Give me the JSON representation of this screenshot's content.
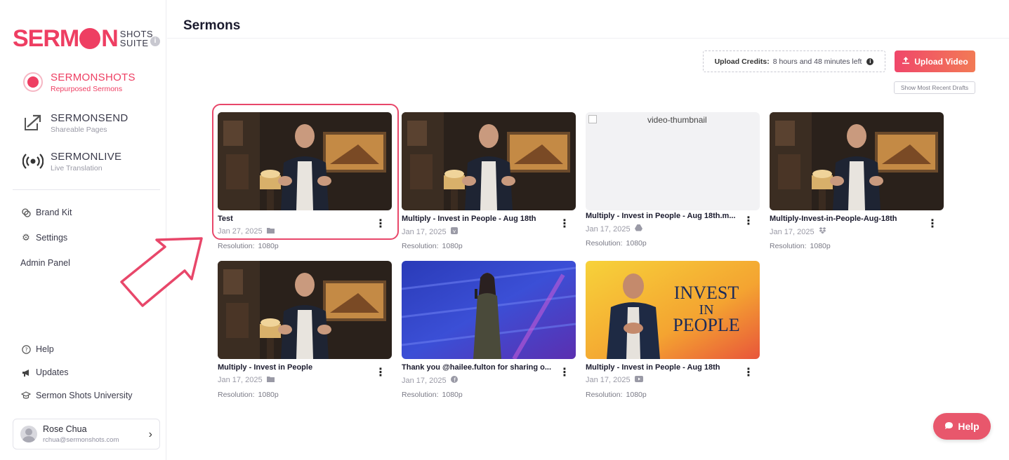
{
  "brand": {
    "logo_main_left": "SERM",
    "logo_main_right": "N",
    "logo_side_top": "SHOTS",
    "logo_side_bottom": "SUITE",
    "accent": "#ee3e62"
  },
  "products": [
    {
      "name": "SERMONSHOTS",
      "sub": "Repurposed Sermons",
      "icon": "record-icon",
      "active": true
    },
    {
      "name": "SERMONSEND",
      "sub": "Shareable Pages",
      "icon": "send-icon",
      "active": false
    },
    {
      "name": "SERMONLIVE",
      "sub": "Live Translation",
      "icon": "broadcast-icon",
      "active": false
    }
  ],
  "nav": {
    "brand_kit": "Brand Kit",
    "settings": "Settings",
    "admin_panel": "Admin Panel",
    "help": "Help",
    "updates": "Updates",
    "university": "Sermon Shots University"
  },
  "user": {
    "name": "Rose Chua",
    "email": "rchua@sermonshots.com"
  },
  "header": {
    "title": "Sermons",
    "credits_label": "Upload Credits:",
    "credits_value": "8 hours and 48 minutes left",
    "upload_label": "Upload Video",
    "drafts_label": "Show Most Recent Drafts"
  },
  "cards": [
    {
      "title": "Test",
      "date": "Jan 27, 2025",
      "source": "folder-icon",
      "res_label": "Resolution:",
      "res": "1080p",
      "thumb": "room"
    },
    {
      "title": "Multiply - Invest in People - Aug 18th",
      "date": "Jan 17, 2025",
      "source": "vimeo-icon",
      "res_label": "Resolution:",
      "res": "1080p",
      "thumb": "room"
    },
    {
      "title": "Multiply - Invest in People - Aug 18th.m...",
      "date": "Jan 17, 2025",
      "source": "google-drive-icon",
      "res_label": "Resolution:",
      "res": "1080p",
      "thumb": "broken",
      "alt": "video-thumbnail"
    },
    {
      "title": "Multiply-Invest-in-People-Aug-18th",
      "date": "Jan 17, 2025",
      "source": "dropbox-icon",
      "res_label": "Resolution:",
      "res": "1080p",
      "thumb": "room"
    },
    {
      "title": "Multiply - Invest in People",
      "date": "Jan 17, 2025",
      "source": "folder-icon",
      "res_label": "Resolution:",
      "res": "1080p",
      "thumb": "room"
    },
    {
      "title": "Thank you @hailee.fulton for sharing o...",
      "date": "Jan 17, 2025",
      "source": "facebook-icon",
      "res_label": "Resolution:",
      "res": "1080p",
      "thumb": "stage"
    },
    {
      "title": "Multiply - Invest in People - Aug 18th",
      "date": "Jan 17, 2025",
      "source": "youtube-icon",
      "res_label": "Resolution:",
      "res": "1080p",
      "thumb": "invest",
      "thumb_text": [
        "INVEST",
        "IN",
        "PEOPLE"
      ]
    }
  ],
  "help_fab": "Help"
}
